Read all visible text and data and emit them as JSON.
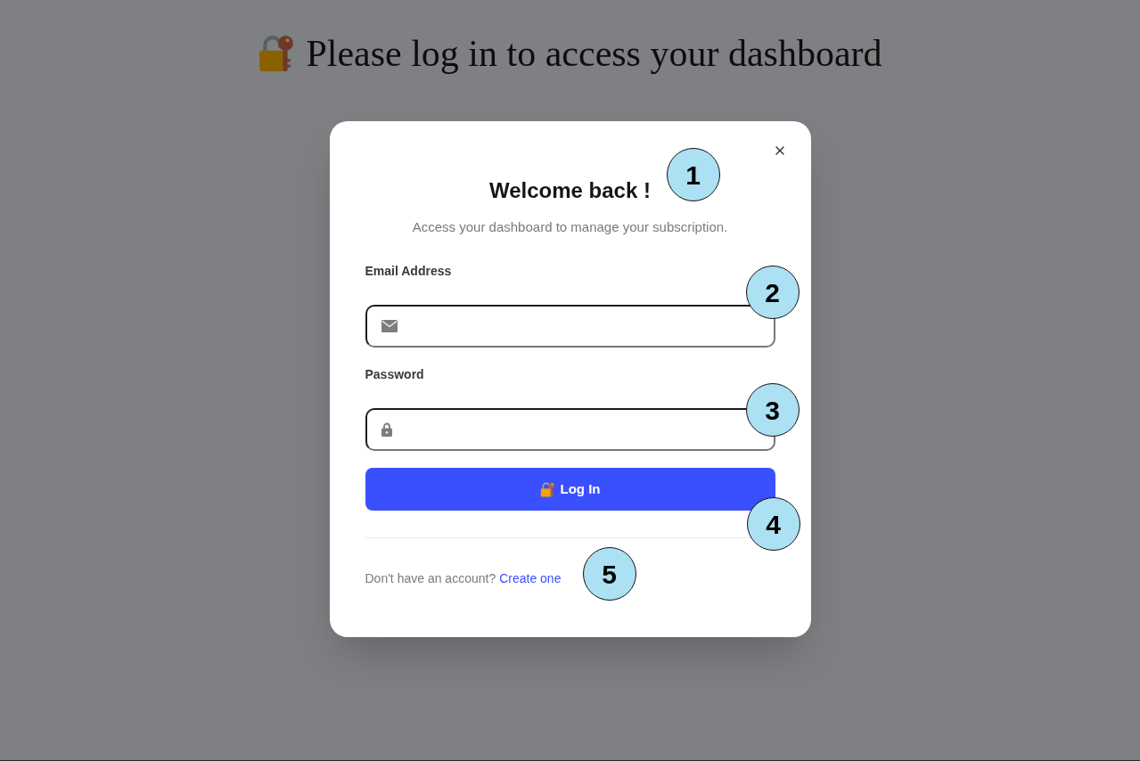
{
  "page_heading": {
    "text": "Please log in to access your dashboard"
  },
  "modal": {
    "title": "Welcome back !",
    "subtitle": "Access your dashboard to manage your subscription.",
    "fields": [
      {
        "kind": "email",
        "label": "Email Address"
      },
      {
        "kind": "password",
        "label": "Password"
      }
    ],
    "submit_button": {
      "label": "Log In"
    },
    "footer": {
      "text": "Don't have an account?",
      "link": "Create one"
    }
  },
  "callouts": [
    "1",
    "2",
    "3",
    "4",
    "5"
  ]
}
